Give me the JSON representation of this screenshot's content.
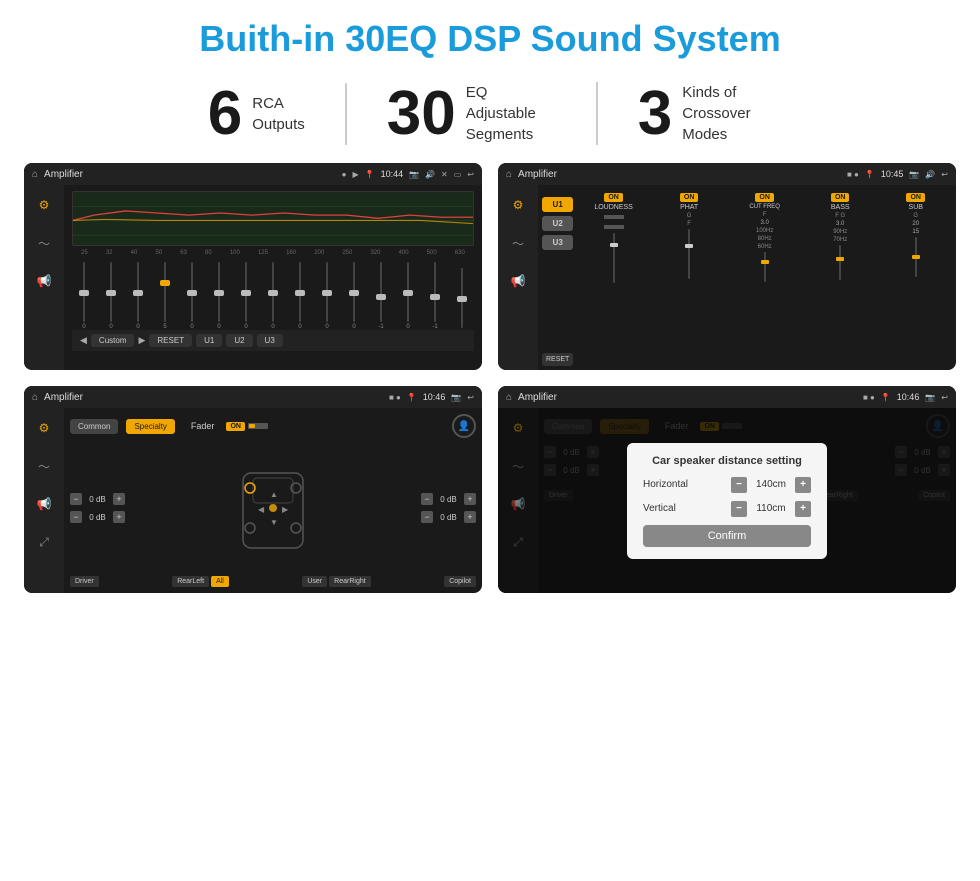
{
  "header": {
    "title": "Buith-in 30EQ DSP Sound System"
  },
  "stats": [
    {
      "number": "6",
      "label": "RCA\nOutputs"
    },
    {
      "number": "30",
      "label": "EQ Adjustable\nSegments"
    },
    {
      "number": "3",
      "label": "Kinds of\nCrossover Modes"
    }
  ],
  "screens": [
    {
      "id": "eq-screen",
      "topbar": {
        "title": "Amplifier",
        "time": "10:44",
        "icons": [
          "●",
          "▶"
        ]
      },
      "type": "eq"
    },
    {
      "id": "amp-screen",
      "topbar": {
        "title": "Amplifier",
        "time": "10:45",
        "icons": [
          "■",
          "●"
        ]
      },
      "type": "crossover"
    },
    {
      "id": "fader-screen",
      "topbar": {
        "title": "Amplifier",
        "time": "10:46",
        "icons": [
          "■",
          "●"
        ]
      },
      "type": "fader"
    },
    {
      "id": "dialog-screen",
      "topbar": {
        "title": "Amplifier",
        "time": "10:46",
        "icons": [
          "■",
          "●"
        ]
      },
      "type": "dialog"
    }
  ],
  "eq": {
    "frequencies": [
      "25",
      "32",
      "40",
      "50",
      "63",
      "80",
      "100",
      "125",
      "160",
      "200",
      "250",
      "320",
      "400",
      "500",
      "630"
    ],
    "values": [
      "0",
      "0",
      "0",
      "5",
      "0",
      "0",
      "0",
      "0",
      "0",
      "0",
      "0",
      "-1",
      "0",
      "-1",
      ""
    ],
    "presets": [
      "Custom",
      "RESET",
      "U1",
      "U2",
      "U3"
    ]
  },
  "crossover": {
    "presets": [
      "U1",
      "U2",
      "U3"
    ],
    "channels": [
      {
        "name": "LOUDNESS",
        "on": true
      },
      {
        "name": "PHAT",
        "on": true
      },
      {
        "name": "CUT FREQ",
        "on": true
      },
      {
        "name": "BASS",
        "on": true
      },
      {
        "name": "SUB",
        "on": true
      }
    ],
    "reset_label": "RESET"
  },
  "fader": {
    "tabs": [
      "Common",
      "Specialty"
    ],
    "fader_label": "Fader",
    "on_label": "ON",
    "db_values": [
      "0 dB",
      "0 dB",
      "0 dB",
      "0 dB"
    ],
    "labels": [
      "Driver",
      "RearLeft",
      "All",
      "User",
      "RearRight",
      "Copilot"
    ]
  },
  "dialog": {
    "title": "Car speaker distance setting",
    "horizontal_label": "Horizontal",
    "horizontal_value": "140cm",
    "vertical_label": "Vertical",
    "vertical_value": "110cm",
    "confirm_label": "Confirm",
    "db_values": [
      "0 dB",
      "0 dB"
    ],
    "tabs": [
      "Common",
      "Specialty"
    ],
    "fader_label": "Fader",
    "on_label": "ON"
  }
}
